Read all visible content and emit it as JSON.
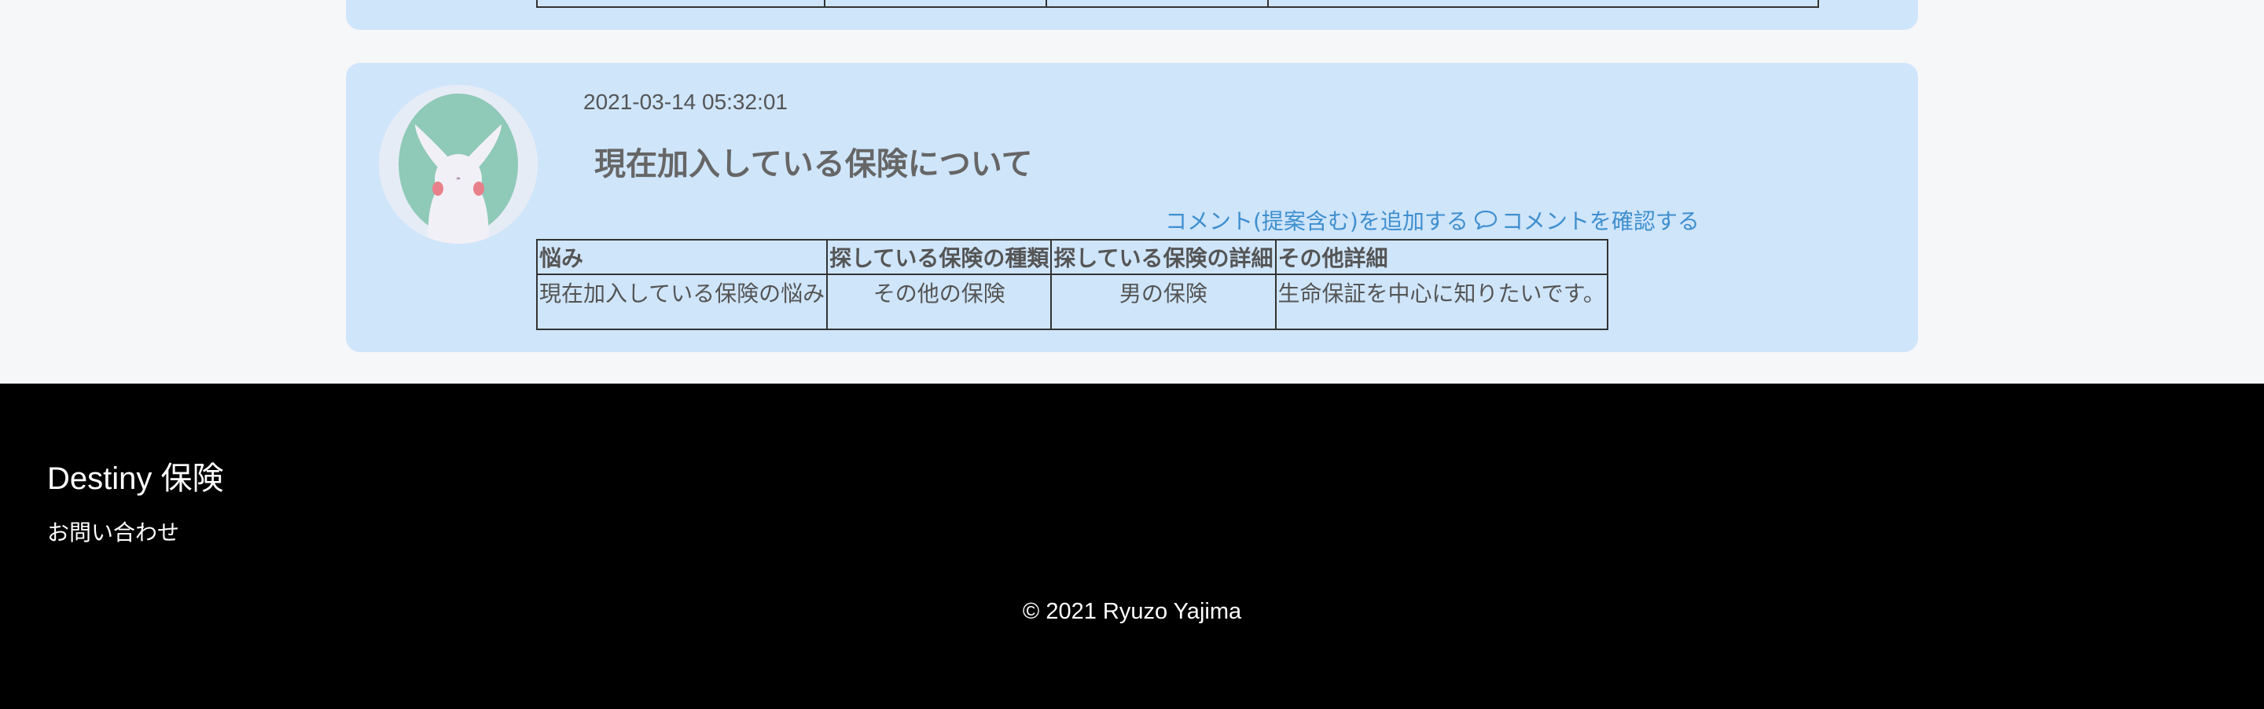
{
  "post": {
    "date": "2021-03-14 05:32:01",
    "title": "現在加入している保険について",
    "add_comment_label": "コメント(提案含む)を追加する",
    "view_comment_label": " コメントを確認する",
    "table": {
      "headers": [
        "悩み",
        "探している保険の種類",
        "探している保険の詳細",
        "その他詳細"
      ],
      "row": [
        "現在加入している保険の悩み",
        "その他の保険",
        "男の保険",
        "生命保証を中心に知りたいです。"
      ]
    },
    "avatar_icon": "rabbit-avatar-icon"
  },
  "footer": {
    "brand": "Destiny 保険",
    "contact_label": "お問い合わせ",
    "copyright": "© 2021 Ryuzo Yajima"
  },
  "colors": {
    "card_background": "#cfe5fa",
    "link": "#3f8fcf",
    "footer_background": "#000000",
    "page_background": "#f6f7f9"
  }
}
